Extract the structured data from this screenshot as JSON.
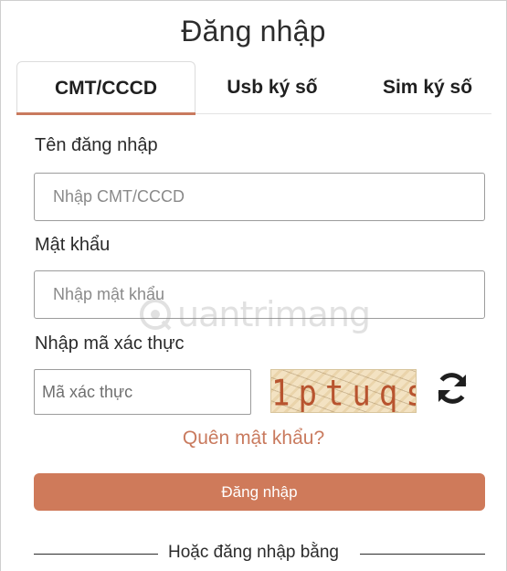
{
  "title": "Đăng nhập",
  "tabs": [
    {
      "label": "CMT/CCCD",
      "active": true
    },
    {
      "label": "Usb ký số",
      "active": false
    },
    {
      "label": "Sim ký số",
      "active": false
    }
  ],
  "username": {
    "label": "Tên đăng nhập",
    "placeholder": "Nhập CMT/CCCD",
    "value": ""
  },
  "password": {
    "label": "Mật khẩu",
    "placeholder": "Nhập mật khẩu",
    "value": ""
  },
  "captcha": {
    "label": "Nhập mã xác thực",
    "placeholder": "Mã xác thực",
    "code": "1ptuqs",
    "refresh_icon": "refresh-icon"
  },
  "forgot_password": "Quên mật khẩu?",
  "login_button": "Đăng nhập",
  "divider_text": "Hoặc đăng nhập bằng",
  "watermark": "uantrimang",
  "colors": {
    "accent": "#cf7a5a",
    "link": "#c97a5e",
    "tab_underline": "#c97a5e"
  }
}
